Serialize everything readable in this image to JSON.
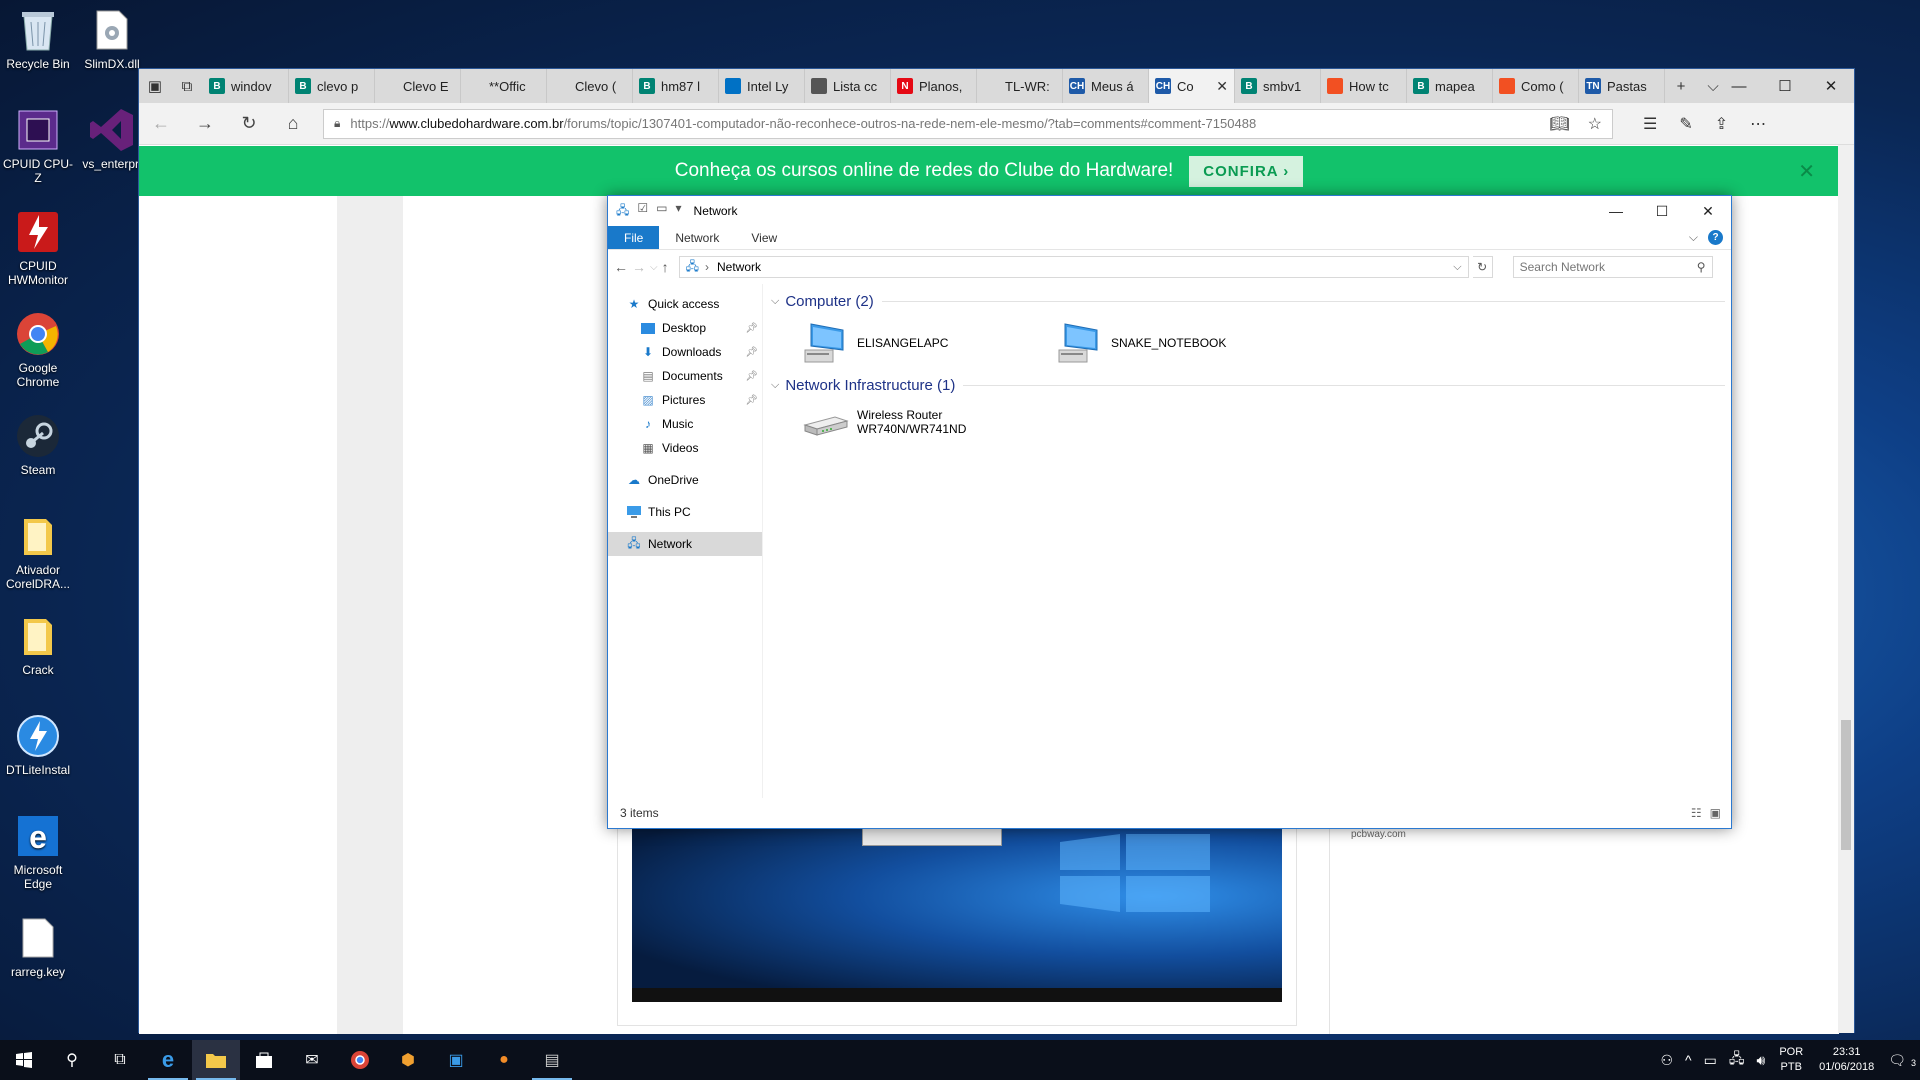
{
  "desktop": {
    "icons": [
      {
        "label": "Recycle Bin",
        "icon": "recycle-bin-icon"
      },
      {
        "label": "SlimDX.dll",
        "icon": "dll-file-icon"
      },
      {
        "label": "CPUID CPU-Z",
        "icon": "cpuz-icon"
      },
      {
        "label": "vs_enterpri",
        "icon": "visual-studio-icon"
      },
      {
        "label": "CPUID HWMonitor",
        "icon": "hwmonitor-icon"
      },
      {
        "label": "Google Chrome",
        "icon": "chrome-icon"
      },
      {
        "label": "Steam",
        "icon": "steam-icon"
      },
      {
        "label": "Ativador CorelDRA...",
        "icon": "folder-icon"
      },
      {
        "label": "Crack",
        "icon": "folder-icon"
      },
      {
        "label": "DTLiteInstal",
        "icon": "daemon-tools-icon"
      },
      {
        "label": "Microsoft Edge",
        "icon": "edge-icon"
      },
      {
        "label": "rarreg.key",
        "icon": "file-icon"
      }
    ]
  },
  "browser": {
    "tabs": [
      {
        "label": "windov",
        "fav": "B",
        "color": "#008373"
      },
      {
        "label": "clevo p",
        "fav": "B",
        "color": "#008373"
      },
      {
        "label": "Clevo E",
        "fav": "",
        "color": "#dadada"
      },
      {
        "label": "**Offic",
        "fav": "",
        "color": "#dadada"
      },
      {
        "label": "Clevo (",
        "fav": "",
        "color": "#dadada"
      },
      {
        "label": "hm87 l",
        "fav": "B",
        "color": "#008373"
      },
      {
        "label": "Intel Ly",
        "fav": "",
        "color": "#0071c5"
      },
      {
        "label": "Lista cc",
        "fav": "",
        "color": "#555555"
      },
      {
        "label": "Planos,",
        "fav": "N",
        "color": "#e50914"
      },
      {
        "label": "TL-WR:",
        "fav": "",
        "color": "#dadada"
      },
      {
        "label": "Meus á",
        "fav": "CH",
        "color": "#1e5aa8"
      },
      {
        "label": "Co",
        "fav": "CH",
        "color": "#1e5aa8",
        "active": true,
        "close": "✕"
      },
      {
        "label": "smbv1",
        "fav": "B",
        "color": "#008373"
      },
      {
        "label": "How tc",
        "fav": "",
        "color": "#f25022"
      },
      {
        "label": "mapea",
        "fav": "B",
        "color": "#008373"
      },
      {
        "label": "Como (",
        "fav": "",
        "color": "#f25022"
      },
      {
        "label": "Pastas",
        "fav": "TN",
        "color": "#1e5aa8"
      }
    ],
    "new_tab": "+",
    "tab_list": "⌵",
    "window": {
      "minimize": "—",
      "maximize": "☐",
      "close": "✕"
    },
    "address": {
      "scheme": "https://",
      "host": "www.clubedohardware.com.br",
      "path": "/forums/topic/1307401-computador-não-reconhece-outros-na-rede-nem-ele-mesmo/?tab=comments#comment-7150488"
    },
    "banner": {
      "text": "Conheça os cursos online de redes do Clube do Hardware!",
      "cta": "CONFIRA ›",
      "close": "✕"
    },
    "sidebar_link": "pcbway.com"
  },
  "explorer": {
    "title": "Network",
    "window": {
      "minimize": "—",
      "maximize": "☐",
      "close": "✕"
    },
    "ribbon_tabs": [
      "File",
      "Network",
      "View"
    ],
    "breadcrumb": "Network",
    "search_placeholder": "Search Network",
    "nav": {
      "quick_access": "Quick access",
      "quick_items": [
        "Desktop",
        "Downloads",
        "Documents",
        "Pictures",
        "Music",
        "Videos"
      ],
      "onedrive": "OneDrive",
      "this_pc": "This PC",
      "network": "Network"
    },
    "groups": {
      "computer": {
        "header": "Computer (2)",
        "items": [
          "ELISANGELAPC",
          "SNAKE_NOTEBOOK"
        ]
      },
      "infrastructure": {
        "header": "Network Infrastructure (1)",
        "items": [
          {
            "line1": "Wireless Router",
            "line2": "WR740N/WR741ND"
          }
        ]
      }
    },
    "status": "3 items"
  },
  "taskbar": {
    "lang_top": "POR",
    "lang_bottom": "PTB",
    "time": "23:31",
    "date": "01/06/2018",
    "notifications": "3"
  }
}
